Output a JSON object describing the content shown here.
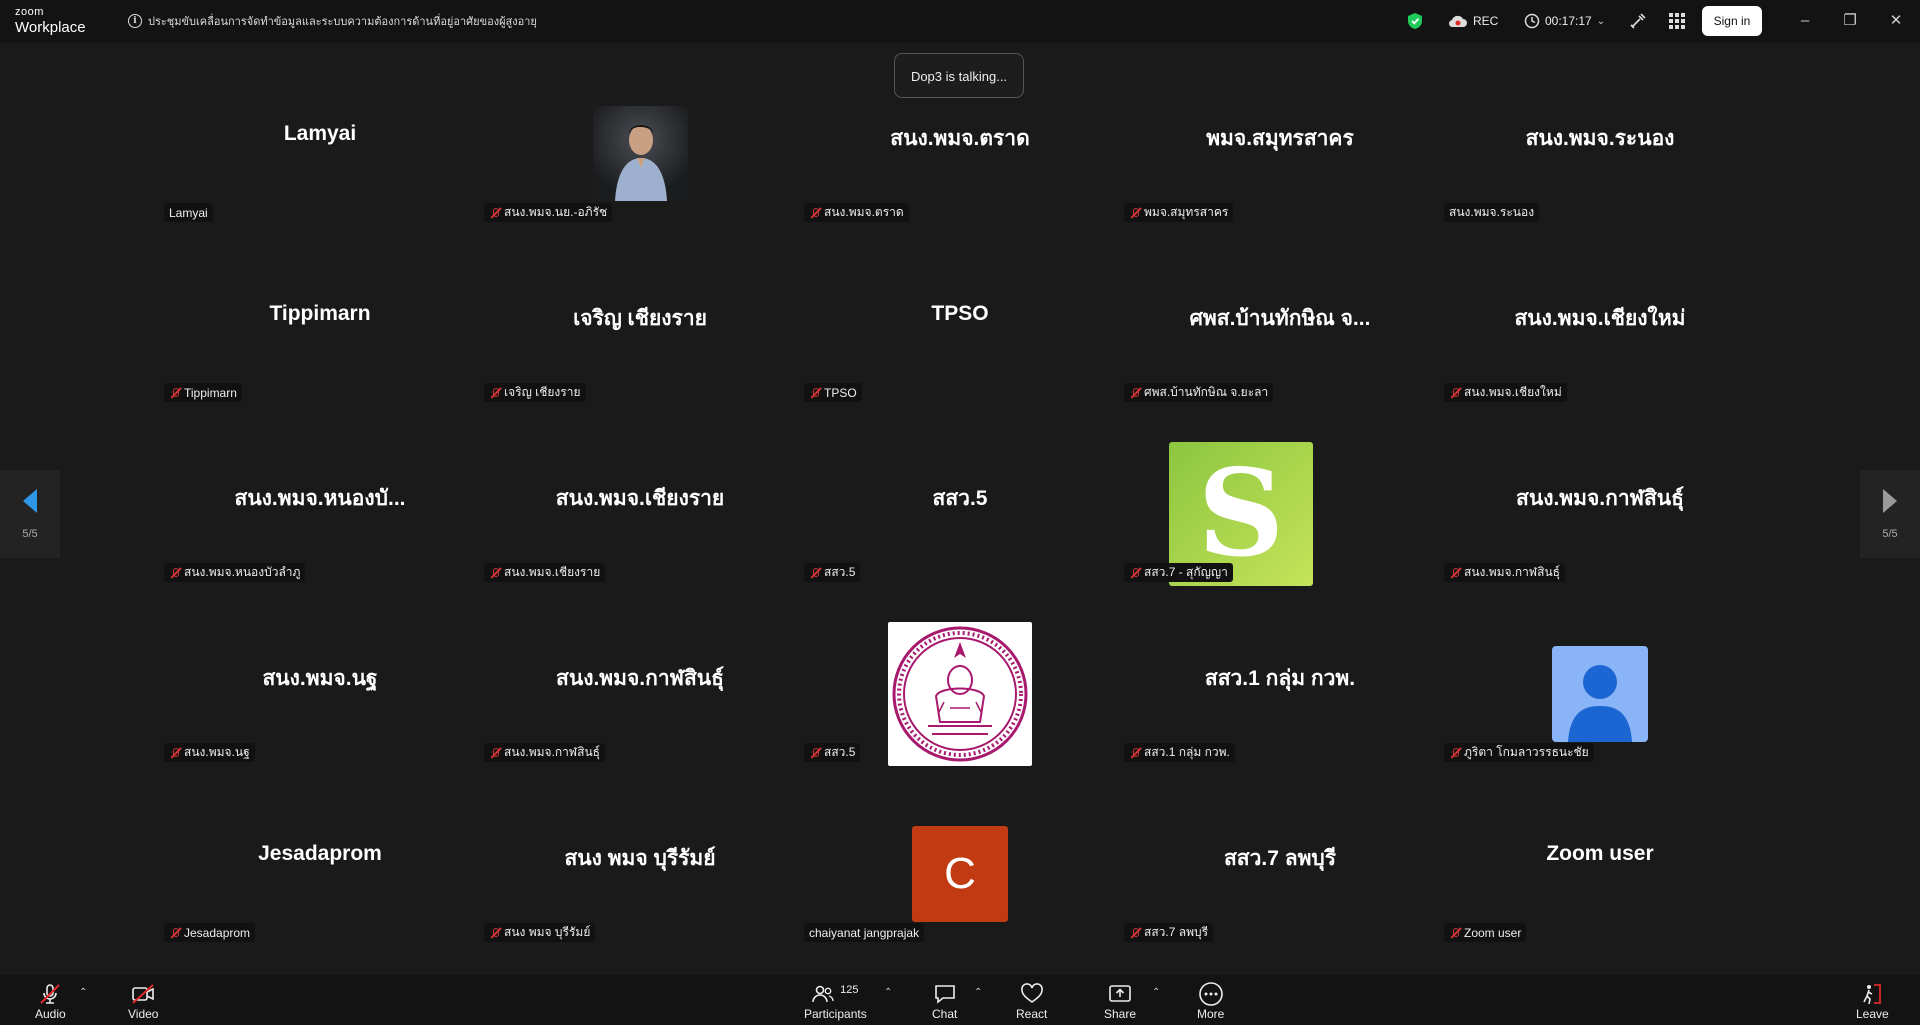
{
  "app": {
    "brand_top": "zoom",
    "brand_bottom": "Workplace"
  },
  "meeting": {
    "title": "ประชุมขับเคลื่อนการจัดทำข้อมูลและระบบความต้องการด้านที่อยู่อาศัยของผู้สูงอายุ"
  },
  "topbar": {
    "rec_label": "REC",
    "timer": "00:17:17",
    "sign_in_label": "Sign in"
  },
  "toast": {
    "text": "Dop3 is talking..."
  },
  "pagination": {
    "left": "5/5",
    "right": "5/5"
  },
  "tiles": [
    {
      "name": "Lamyai",
      "label": "Lamyai",
      "muted": false
    },
    {
      "name": "",
      "label": "สนง.พมจ.นย.-อภิรัช",
      "muted": true,
      "avatar": "photo"
    },
    {
      "name": "สนง.พมจ.ตราด",
      "label": "สนง.พมจ.ตราด",
      "muted": true
    },
    {
      "name": "พมจ.สมุทรสาคร",
      "label": "พมจ.สมุทรสาคร",
      "muted": true
    },
    {
      "name": "สนง.พมจ.ระนอง",
      "label": "สนง.พมจ.ระนอง",
      "muted": false
    },
    {
      "name": "Tippimarn",
      "label": "Tippimarn",
      "muted": true
    },
    {
      "name": "เจริญ เชียงราย",
      "label": "เจริญ เชียงราย",
      "muted": true
    },
    {
      "name": "TPSO",
      "label": "TPSO",
      "muted": true
    },
    {
      "name": "ศพส.บ้านทักษิณ จ...",
      "label": "ศพส.บ้านทักษิณ จ.ยะลา",
      "muted": true
    },
    {
      "name": "สนง.พมจ.เชียงใหม่",
      "label": "สนง.พมจ.เชียงใหม่",
      "muted": true
    },
    {
      "name": "สนง.พมจ.หนองบั...",
      "label": "สนง.พมจ.หนองบัวลำภู",
      "muted": true
    },
    {
      "name": "สนง.พมจ.เชียงราย",
      "label": "สนง.พมจ.เชียงราย",
      "muted": true
    },
    {
      "name": "สสว.5",
      "label": "สสว.5",
      "muted": true
    },
    {
      "name": "",
      "label": "สสว.7 - สุกัญญา",
      "muted": true,
      "avatar": "s-logo",
      "avatar_letter": "S"
    },
    {
      "name": "สนง.พมจ.กาฬสินธุ์",
      "label": "สนง.พมจ.กาฬสินธุ์",
      "muted": true
    },
    {
      "name": "สนง.พมจ.นฐ",
      "label": "สนง.พมจ.นฐ",
      "muted": true
    },
    {
      "name": "สนง.พมจ.กาฬสินธุ์",
      "label": "สนง.พมจ.กาฬสินธุ์",
      "muted": true
    },
    {
      "name": "",
      "label": "สสว.5",
      "muted": true,
      "avatar": "seal"
    },
    {
      "name": "สสว.1 กลุ่ม กวพ.",
      "label": "สสว.1 กลุ่ม กวพ.",
      "muted": true
    },
    {
      "name": "",
      "label": "ภูริตา โกมลาวรรธนะชัย",
      "muted": true,
      "avatar": "person"
    },
    {
      "name": "Jesadaprom",
      "label": "Jesadaprom",
      "muted": true
    },
    {
      "name": "สนง พมจ บุรีรัมย์",
      "label": "สนง พมจ บุรีรัมย์",
      "muted": true
    },
    {
      "name": "",
      "label": "chaiyanat jangprajak",
      "muted": false,
      "avatar": "letter",
      "avatar_letter": "C"
    },
    {
      "name": "สสว.7 ลพบุรี",
      "label": "สสว.7 ลพบุรี",
      "muted": true
    },
    {
      "name": "Zoom user",
      "label": "Zoom user",
      "muted": true
    }
  ],
  "bottombar": {
    "audio": "Audio",
    "video": "Video",
    "participants": "Participants",
    "participants_count": "125",
    "chat": "Chat",
    "react": "React",
    "share": "Share",
    "more": "More",
    "leave": "Leave"
  },
  "colors": {
    "background": "#1a1a1a",
    "muted_icon": "#d13438",
    "s_logo": "#9dd442",
    "letter_avatar": "#c23a12",
    "person_avatar": "#8ab4f8"
  }
}
